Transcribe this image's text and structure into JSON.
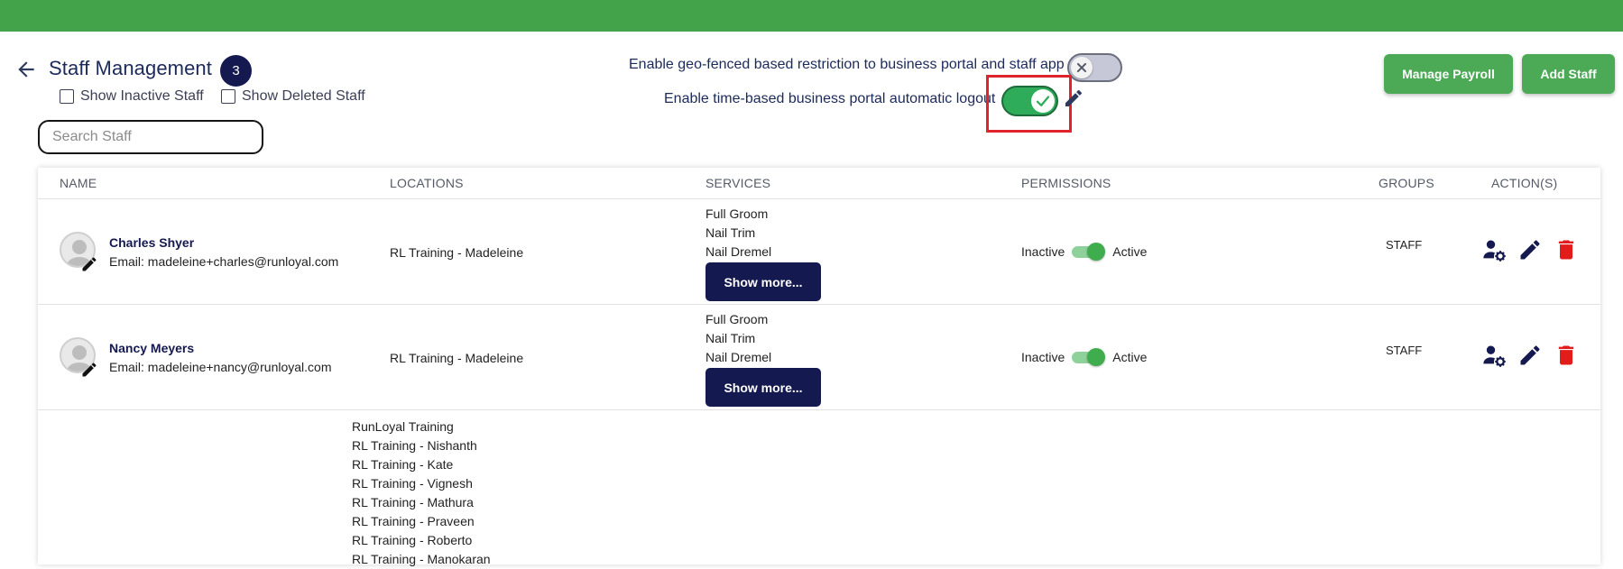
{
  "header": {
    "title": "Staff Management",
    "count": "3",
    "show_inactive_label": "Show Inactive Staff",
    "show_deleted_label": "Show Deleted Staff",
    "search_placeholder": "Search Staff",
    "geo_fence_label": "Enable geo-fenced based restriction to business portal and staff app",
    "geo_fence_enabled": false,
    "time_logout_label": "Enable time-based business portal automatic logout",
    "time_logout_enabled": true,
    "manage_payroll_label": "Manage Payroll",
    "add_staff_label": "Add Staff"
  },
  "table": {
    "columns": [
      "NAME",
      "LOCATIONS",
      "SERVICES",
      "PERMISSIONS",
      "GROUPS",
      "ACTION(S)"
    ],
    "rows": [
      {
        "name": "Charles Shyer",
        "email": "Email: madeleine+charles@runloyal.com",
        "location": "RL Training - Madeleine",
        "services": [
          "Full Groom",
          "Nail Trim",
          "Nail Dremel"
        ],
        "show_more": "Show more...",
        "perm_inactive": "Inactive",
        "perm_active": "Active",
        "group": "STAFF"
      },
      {
        "name": "Nancy Meyers",
        "email": "Email: madeleine+nancy@runloyal.com",
        "location": "RL Training - Madeleine",
        "services": [
          "Full Groom",
          "Nail Trim",
          "Nail Dremel"
        ],
        "show_more": "Show more...",
        "perm_inactive": "Inactive",
        "perm_active": "Active",
        "group": "STAFF"
      }
    ],
    "third_row_locations": [
      "RunLoyal Training",
      "RL Training - Nishanth",
      "RL Training - Kate",
      "RL Training - Vignesh",
      "RL Training - Mathura",
      "RL Training - Praveen",
      "RL Training - Roberto",
      "RL Training - Manokaran"
    ]
  },
  "colors": {
    "topbar": "#43a34b",
    "accent_green": "#4caa57",
    "navy": "#14194f",
    "delete_red": "#e21b1b",
    "highlight_red": "#e0242b"
  },
  "icons": {
    "back": "arrow-left-icon",
    "toggle_off": "close-icon",
    "toggle_on": "check-icon",
    "edit": "pencil-icon",
    "permissions": "user-settings-icon",
    "delete": "trash-icon"
  }
}
